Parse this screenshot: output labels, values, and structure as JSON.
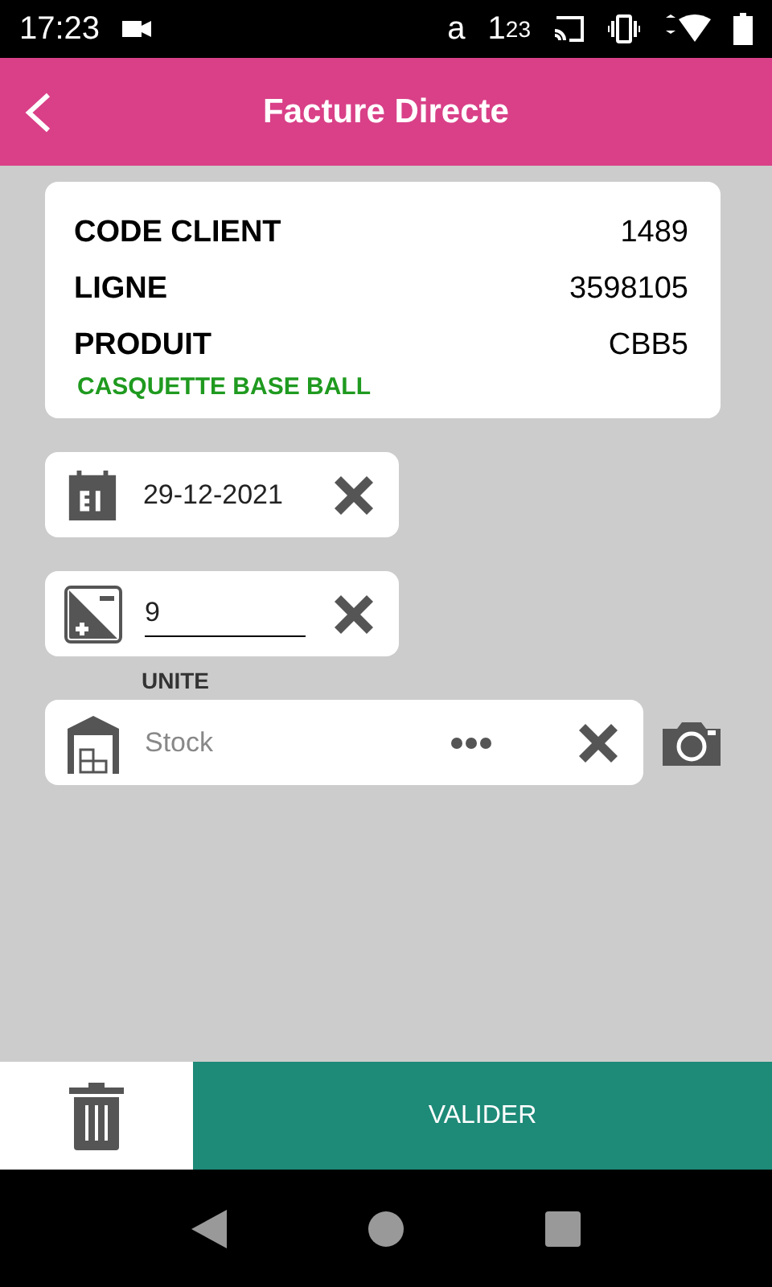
{
  "status_bar": {
    "time": "17:23",
    "indicators": [
      "a",
      "1",
      "23"
    ]
  },
  "header": {
    "title": "Facture Directe"
  },
  "info": {
    "rows": [
      {
        "label": "CODE CLIENT",
        "value": "1489"
      },
      {
        "label": "LIGNE",
        "value": "3598105"
      },
      {
        "label": "PRODUIT",
        "value": "CBB5"
      }
    ],
    "description": "CASQUETTE BASE BALL"
  },
  "date_field": {
    "value": "29-12-2021"
  },
  "quantity_field": {
    "value": "9"
  },
  "unit_field": {
    "label": "UNITE",
    "placeholder": "Stock"
  },
  "actions": {
    "validate": "VALIDER"
  }
}
